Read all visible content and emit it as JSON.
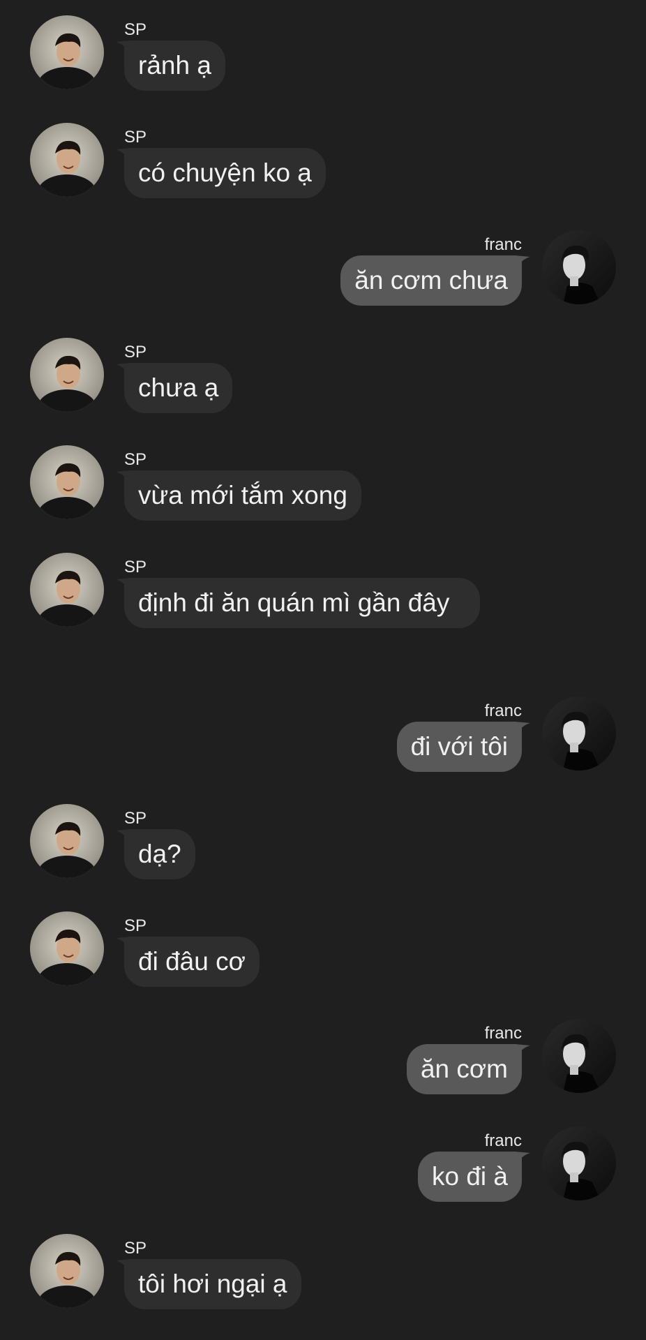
{
  "colors": {
    "background": "#1f1f1f",
    "incoming_bubble": "#2e2e2e",
    "outgoing_bubble": "#595959",
    "text": "#f1f1f1"
  },
  "messages": [
    {
      "side": "left",
      "sender": "SP",
      "text": "rảnh ạ"
    },
    {
      "side": "left",
      "sender": "SP",
      "text": "có chuyện ko ạ"
    },
    {
      "side": "right",
      "sender": "franc",
      "text": "ăn cơm chưa"
    },
    {
      "side": "left",
      "sender": "SP",
      "text": "chưa ạ"
    },
    {
      "side": "left",
      "sender": "SP",
      "text": "vừa mới tắm xong"
    },
    {
      "side": "left",
      "sender": "SP",
      "text": "định đi ăn quán mì gần đây"
    },
    {
      "side": "right",
      "sender": "franc",
      "text": "đi với tôi"
    },
    {
      "side": "left",
      "sender": "SP",
      "text": "dạ?"
    },
    {
      "side": "left",
      "sender": "SP",
      "text": "đi đâu cơ"
    },
    {
      "side": "right",
      "sender": "franc",
      "text": "ăn cơm"
    },
    {
      "side": "right",
      "sender": "franc",
      "text": "ko đi à"
    },
    {
      "side": "left",
      "sender": "SP",
      "text": "tôi hơi ngại ạ"
    }
  ]
}
